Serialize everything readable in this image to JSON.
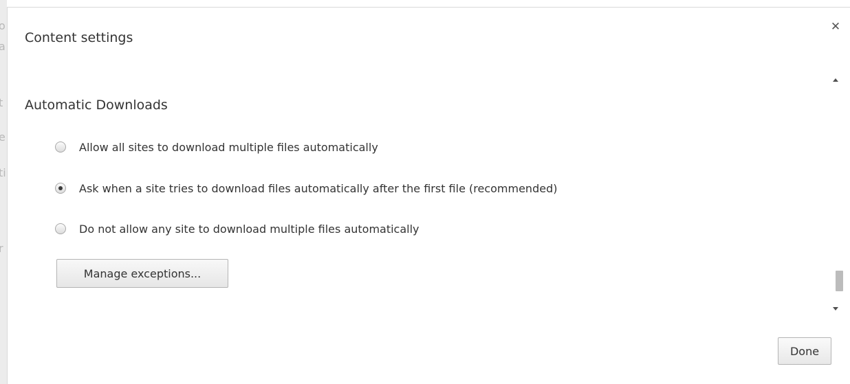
{
  "dialog": {
    "title": "Content settings",
    "close_icon": "close-icon"
  },
  "section": {
    "title": "Automatic Downloads",
    "options": [
      {
        "label": "Allow all sites to download multiple files automatically",
        "checked": false
      },
      {
        "label": "Ask when a site tries to download files automatically after the first file (recommended)",
        "checked": true
      },
      {
        "label": "Do not allow any site to download multiple files automatically",
        "checked": false
      }
    ],
    "manage_label": "Manage exceptions..."
  },
  "footer": {
    "done_label": "Done"
  },
  "colors": {
    "text": "#333333",
    "button_border": "#b4b4b4",
    "scroll_thumb": "#bcbcbc"
  }
}
